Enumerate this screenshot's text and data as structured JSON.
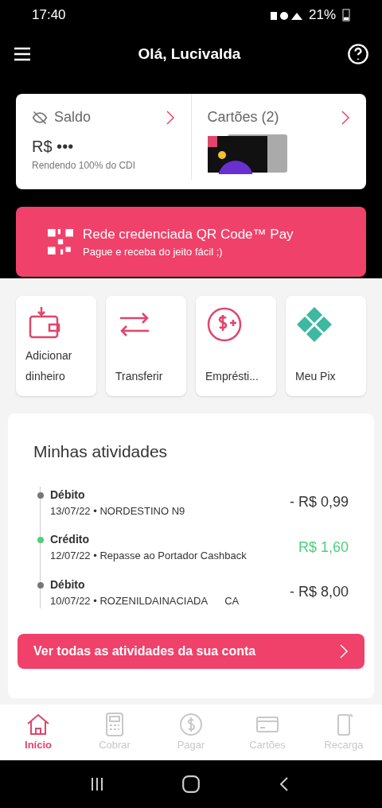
{
  "status_bar": {
    "time": "17:40",
    "battery": "21%"
  },
  "header": {
    "title": "Olá, Lucivalda"
  },
  "balance_card": {
    "label": "Saldo",
    "value": "R$ •••",
    "note": "Rendendo 100% do CDI"
  },
  "cards_card": {
    "label": "Cartões (2)"
  },
  "banner": {
    "title": "Rede credenciada QR Code™ Pay",
    "subtitle": "Pague e receba do jeito fácil ;)"
  },
  "actions": [
    {
      "kind": "wallet",
      "label": "Adicionar dinheiro"
    },
    {
      "kind": "transfer",
      "label": "Transferir"
    },
    {
      "kind": "loan",
      "label": "Emprésti..."
    },
    {
      "kind": "pix",
      "label": "Meu Pix"
    }
  ],
  "activities": {
    "title": "Minhas atividades",
    "items": [
      {
        "kind": "debit",
        "label": "Débito",
        "date": "13/07/22 •",
        "description": "NORDESTINO N9",
        "amount": "- R$ 0,99"
      },
      {
        "kind": "credit",
        "label": "Crédito",
        "date": "12/07/22 •",
        "description": "Repasse ao Portador Cashback",
        "amount": "R$ 1,60"
      },
      {
        "kind": "debit",
        "label": "Débito",
        "date": "10/07/22 •",
        "description": "ROZENILDAINACIADA      CA",
        "amount": "- R$ 8,00"
      }
    ],
    "button": "Ver todas as atividades da sua conta"
  },
  "bottom_nav": [
    {
      "kind": "home",
      "label": "Início",
      "selected": true
    },
    {
      "kind": "calc",
      "label": "Cobrar",
      "selected": false
    },
    {
      "kind": "pay",
      "label": "Pagar",
      "selected": false
    },
    {
      "kind": "card",
      "label": "Cartões",
      "selected": false
    },
    {
      "kind": "phone",
      "label": "Recarga",
      "selected": false
    }
  ]
}
